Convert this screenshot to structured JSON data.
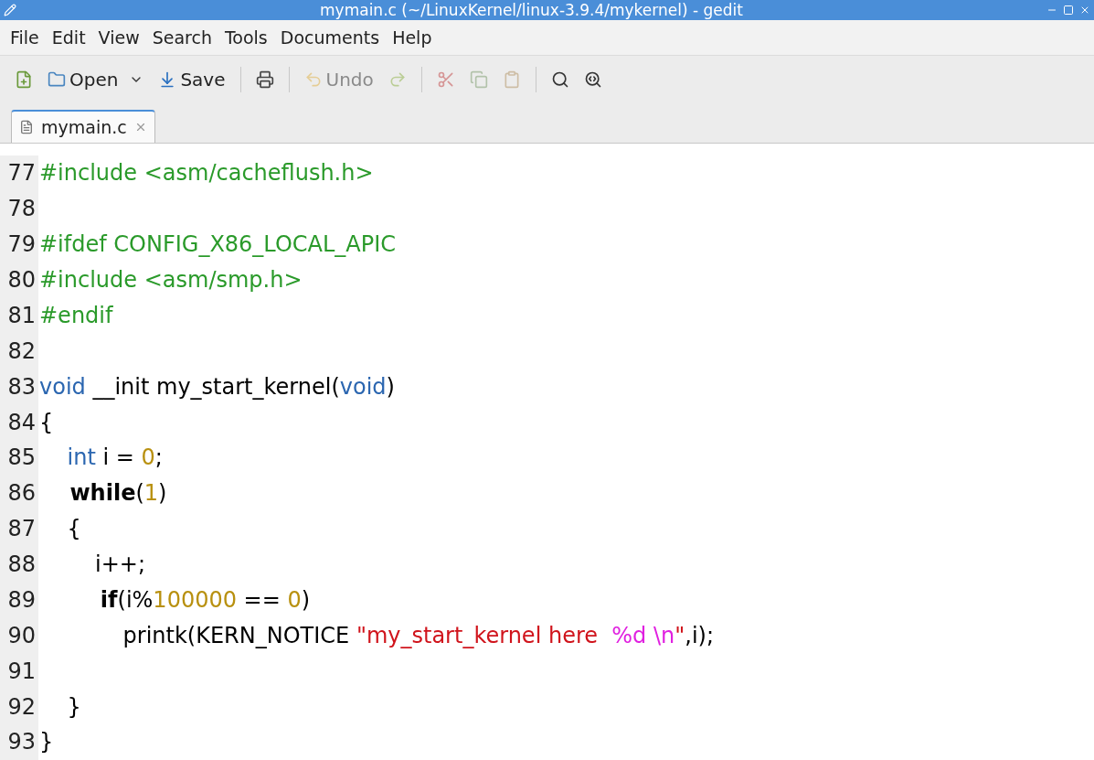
{
  "window": {
    "title": "mymain.c (~/LinuxKernel/linux-3.9.4/mykernel) - gedit"
  },
  "menu": [
    "File",
    "Edit",
    "View",
    "Search",
    "Tools",
    "Documents",
    "Help"
  ],
  "toolbar": [
    {
      "kind": "new",
      "disabled": false
    },
    {
      "kind": "open",
      "label": "Open",
      "disabled": false
    },
    {
      "kind": "save",
      "label": "Save",
      "disabled": false
    },
    {
      "kind": "sep"
    },
    {
      "kind": "print",
      "disabled": false
    },
    {
      "kind": "sep"
    },
    {
      "kind": "undo",
      "label": "Undo",
      "disabled": true
    },
    {
      "kind": "redo",
      "disabled": true
    },
    {
      "kind": "sep"
    },
    {
      "kind": "cut",
      "disabled": true
    },
    {
      "kind": "copy",
      "disabled": true
    },
    {
      "kind": "paste",
      "disabled": true
    },
    {
      "kind": "sep"
    },
    {
      "kind": "find",
      "disabled": false
    },
    {
      "kind": "replace",
      "disabled": false
    }
  ],
  "tabs": [
    {
      "label": "mymain.c",
      "selected": true
    }
  ],
  "lines": [
    {
      "number": "77",
      "tokens": [
        {
          "kind": "pre",
          "text": "#include <asm/cacheflush.h>"
        }
      ]
    },
    {
      "number": "78"
    },
    {
      "number": "79",
      "tokens": [
        {
          "kind": "pre",
          "text": "#ifdef CONFIG_X86_LOCAL_APIC"
        }
      ]
    },
    {
      "number": "80",
      "tokens": [
        {
          "kind": "pre",
          "text": "#include <asm/smp.h>"
        }
      ]
    },
    {
      "number": "81",
      "tokens": [
        {
          "kind": "pre",
          "text": "#endif"
        }
      ]
    },
    {
      "number": "82"
    },
    {
      "number": "83",
      "tokens": [
        {
          "kind": "type",
          "text": "void"
        },
        {
          "kind": "plain",
          "text": " __init my_start_kernel("
        },
        {
          "kind": "type",
          "text": "void"
        },
        {
          "kind": "plain",
          "text": ")"
        }
      ]
    },
    {
      "number": "84",
      "tokens": [
        {
          "kind": "plain",
          "text": "{"
        }
      ]
    },
    {
      "number": "85",
      "tokens": [
        {
          "kind": "type",
          "text": "    int"
        },
        {
          "kind": "plain",
          "text": " i = "
        },
        {
          "kind": "num",
          "text": "0"
        },
        {
          "kind": "plain",
          "text": ";"
        }
      ]
    },
    {
      "number": "86",
      "tokens": [
        {
          "kind": "kw",
          "text": "    while"
        },
        {
          "kind": "plain",
          "text": "("
        },
        {
          "kind": "num",
          "text": "1"
        },
        {
          "kind": "plain",
          "text": ")"
        }
      ]
    },
    {
      "number": "87",
      "tokens": [
        {
          "kind": "plain",
          "text": "    {"
        }
      ]
    },
    {
      "number": "88",
      "tokens": [
        {
          "kind": "plain",
          "text": "        i++;"
        }
      ]
    },
    {
      "number": "89",
      "tokens": [
        {
          "kind": "kw",
          "text": "        if"
        },
        {
          "kind": "plain",
          "text": "(i%"
        },
        {
          "kind": "num",
          "text": "100000"
        },
        {
          "kind": "plain",
          "text": " == "
        },
        {
          "kind": "num",
          "text": "0"
        },
        {
          "kind": "plain",
          "text": ")"
        }
      ]
    },
    {
      "number": "90",
      "tokens": [
        {
          "kind": "plain",
          "text": "            printk(KERN_NOTICE "
        },
        {
          "kind": "str",
          "text": "\"my_start_kernel here  "
        },
        {
          "kind": "fmt",
          "text": "%d \\n"
        },
        {
          "kind": "str",
          "text": "\""
        },
        {
          "kind": "plain",
          "text": ",i);"
        }
      ]
    },
    {
      "number": "91"
    },
    {
      "number": "92",
      "tokens": [
        {
          "kind": "plain",
          "text": "    }"
        }
      ]
    },
    {
      "number": "93",
      "tokens": [
        {
          "kind": "plain",
          "text": "}"
        }
      ]
    }
  ]
}
